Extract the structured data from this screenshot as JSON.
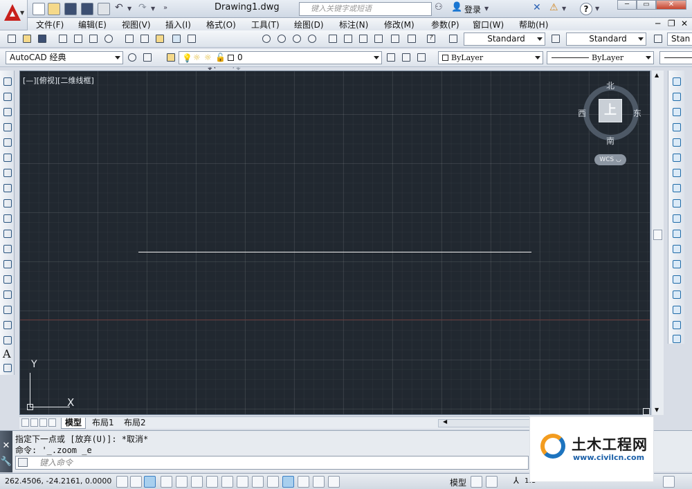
{
  "app": {
    "document_title": "Drawing1.dwg",
    "search_placeholder": "键入关键字或短语",
    "login_label": "登录",
    "help_icon_label": "?"
  },
  "menu": [
    "文件(F)",
    "编辑(E)",
    "视图(V)",
    "插入(I)",
    "格式(O)",
    "工具(T)",
    "绘图(D)",
    "标注(N)",
    "修改(M)",
    "参数(P)",
    "窗口(W)",
    "帮助(H)"
  ],
  "toolbar_styles": {
    "text_style": "Standard",
    "dim_style": "Standard",
    "table_style_partial": "Stan"
  },
  "toolbar_layers": {
    "workspace": "AutoCAD 经典",
    "layer": "0",
    "color": "ByLayer",
    "linetype": "ByLayer"
  },
  "canvas": {
    "viewport_label": "[—][俯视][二维线框]",
    "background_color": "#212830"
  },
  "viewcube": {
    "north": "北",
    "south": "南",
    "east": "东",
    "west": "西",
    "face": "上",
    "wcs": "WCS"
  },
  "ucs": {
    "x_label": "X",
    "y_label": "Y"
  },
  "layout_tabs": [
    "模型",
    "布局1",
    "布局2"
  ],
  "command": {
    "history": [
      "指定下一点或 [放弃(U)]: *取消*",
      "命令: '_.zoom _e"
    ],
    "input_placeholder": "键入命令"
  },
  "status": {
    "coordinates": "262.4506,  -24.2161,  0.0000",
    "model_label": "模型",
    "scale": "1:1"
  },
  "watermark": {
    "title": "土木工程网",
    "url": "www.civilcn.com"
  }
}
